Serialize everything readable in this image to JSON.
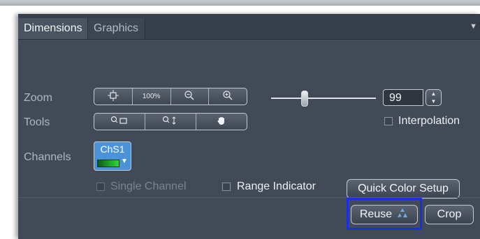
{
  "tabs": {
    "dimensions": "Dimensions",
    "graphics": "Graphics"
  },
  "labels": {
    "zoom": "Zoom",
    "tools": "Tools",
    "channels": "Channels"
  },
  "zoom_buttons": {
    "fit_icon": "fit-to-window-icon",
    "hundred": "100%",
    "zoom_out_icon": "zoom-out-icon",
    "zoom_in_icon": "zoom-in-icon"
  },
  "tool_buttons": {
    "zoom_rect_icon": "zoom-rectangle-icon",
    "zoom_drag_icon": "zoom-drag-icon",
    "pan_icon": "hand-icon"
  },
  "zoom_value": "99",
  "interpolation": {
    "label": "Interpolation",
    "checked": false
  },
  "channel": {
    "name": "ChS1",
    "color": "#22c22e"
  },
  "single_channel": {
    "label": "Single Channel",
    "checked": false,
    "enabled": false
  },
  "range_indicator": {
    "label": "Range Indicator",
    "checked": false
  },
  "buttons": {
    "quick_color_setup": "Quick Color Setup",
    "reuse": "Reuse",
    "crop": "Crop"
  },
  "colors": {
    "panel_bg": "#414a56",
    "highlight": "#1a2ee6",
    "channel_button": "#4a93d8"
  }
}
